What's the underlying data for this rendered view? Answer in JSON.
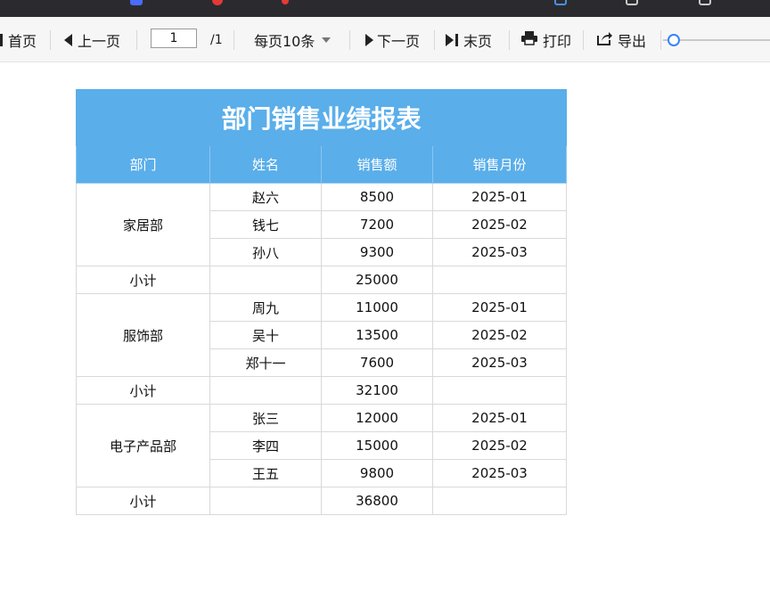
{
  "toolbar": {
    "first_label": "首页",
    "prev_label": "上一页",
    "page_input_value": "1",
    "page_total": "/1",
    "page_size_label": "每页10条",
    "next_label": "下一页",
    "last_label": "末页",
    "print_label": "打印",
    "export_label": "导出",
    "zoom_level": 0.1
  },
  "report": {
    "title": "部门销售业绩报表",
    "headers": [
      "部门",
      "姓名",
      "销售额",
      "销售月份"
    ],
    "groups": [
      {
        "dept": "家居部",
        "rows": [
          {
            "name": "赵六",
            "amount": "8500",
            "month": "2025-01"
          },
          {
            "name": "钱七",
            "amount": "7200",
            "month": "2025-02"
          },
          {
            "name": "孙八",
            "amount": "9300",
            "month": "2025-03"
          }
        ],
        "subtotal_label": "小计",
        "subtotal": "25000"
      },
      {
        "dept": "服饰部",
        "rows": [
          {
            "name": "周九",
            "amount": "11000",
            "month": "2025-01"
          },
          {
            "name": "吴十",
            "amount": "13500",
            "month": "2025-02"
          },
          {
            "name": "郑十一",
            "amount": "7600",
            "month": "2025-03"
          }
        ],
        "subtotal_label": "小计",
        "subtotal": "32100"
      },
      {
        "dept": "电子产品部",
        "rows": [
          {
            "name": "张三",
            "amount": "12000",
            "month": "2025-01"
          },
          {
            "name": "李四",
            "amount": "15000",
            "month": "2025-02"
          },
          {
            "name": "王五",
            "amount": "9800",
            "month": "2025-03"
          }
        ],
        "subtotal_label": "小计",
        "subtotal": "36800"
      }
    ]
  }
}
